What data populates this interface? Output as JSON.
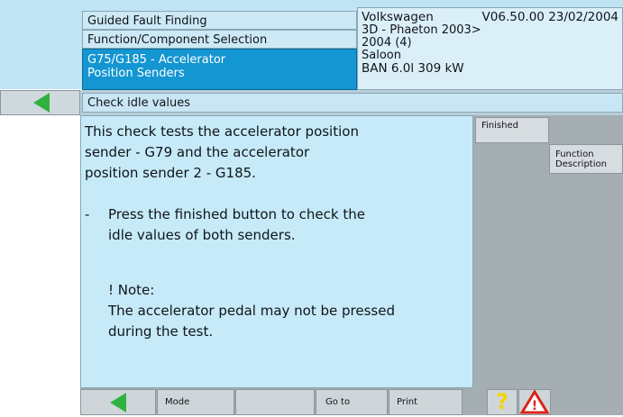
{
  "header": {
    "breadcrumbs": [
      "Guided Fault Finding",
      "Function/Component Selection"
    ],
    "active_crumb_line1": "G75/G185 - Accelerator",
    "active_crumb_line2": "Position Senders",
    "vehicle": {
      "make": "Volkswagen",
      "version": "V06.50.00 23/02/2004",
      "model": "3D - Phaeton 2003>",
      "year": "2004 (4)",
      "body": "Saloon",
      "engine": "BAN 6.0l 309 kW"
    }
  },
  "page": {
    "title": "Check idle values",
    "intro_lines": [
      "This check tests the accelerator position",
      "sender - G79 and the accelerator",
      "position sender 2 - G185."
    ],
    "bullet_dash": "-",
    "bullet_lines": [
      "Press the finished button to check the",
      "idle values of both senders."
    ],
    "note_heading": "! Note:",
    "note_lines": [
      "The accelerator pedal may not be pressed",
      "during the test."
    ]
  },
  "side_buttons": {
    "finished": "Finished",
    "function_line1": "Function",
    "function_line2": "Description"
  },
  "bottom_bar": {
    "mode": "Mode",
    "goto": "Go to",
    "print": "Print",
    "help_glyph": "?",
    "warn_glyph": "!"
  },
  "colors": {
    "header_bg": "#bfe5f5",
    "active_crumb": "#1496d2",
    "panel_bg": "#c6eaf8",
    "button_gray": "#cfd6d9",
    "back_arrow": "#2fb33e",
    "help_yellow": "#f5d300",
    "warning_red": "#d9241c"
  },
  "icons": [
    "back-arrow-icon",
    "help-icon",
    "warning-icon"
  ]
}
